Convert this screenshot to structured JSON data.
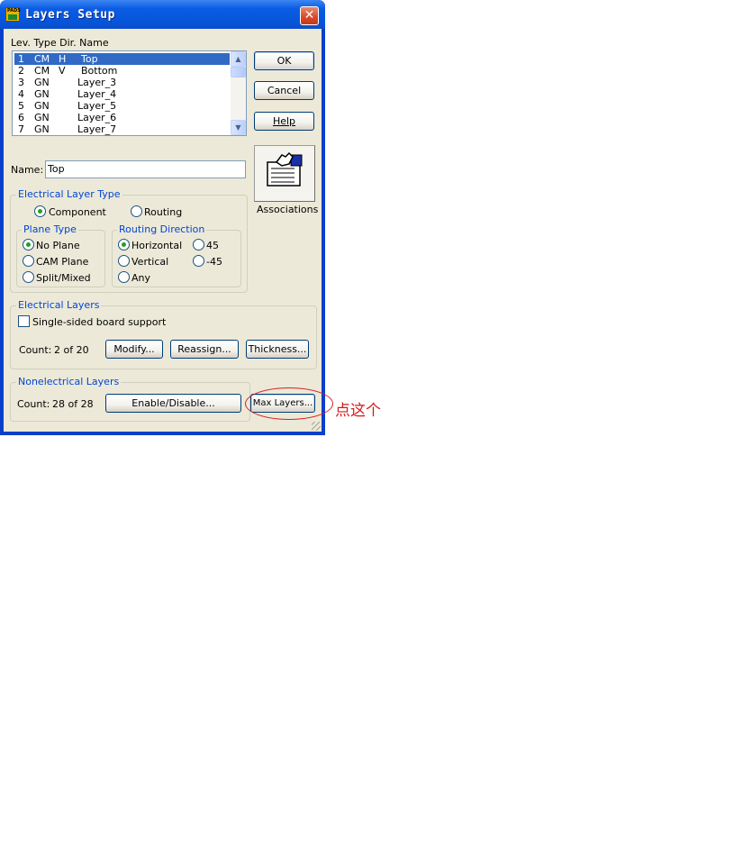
{
  "window": {
    "title": "Layers Setup",
    "app_icon_text": "PADS"
  },
  "list": {
    "header": "Lev. Type Dir. Name",
    "rows": [
      {
        "lev": "1",
        "type": "CM",
        "dir": "H",
        "name": "Top"
      },
      {
        "lev": "2",
        "type": "CM",
        "dir": "V",
        "name": "Bottom"
      },
      {
        "lev": "3",
        "type": "GN",
        "dir": "",
        "name": "Layer_3"
      },
      {
        "lev": "4",
        "type": "GN",
        "dir": "",
        "name": "Layer_4"
      },
      {
        "lev": "5",
        "type": "GN",
        "dir": "",
        "name": "Layer_5"
      },
      {
        "lev": "6",
        "type": "GN",
        "dir": "",
        "name": "Layer_6"
      },
      {
        "lev": "7",
        "type": "GN",
        "dir": "",
        "name": "Layer_7"
      }
    ],
    "selected": "1"
  },
  "buttons": {
    "ok": "OK",
    "cancel": "Cancel",
    "help": "Help",
    "associations": "Associations"
  },
  "name_field": {
    "label": "Name:",
    "value": "Top"
  },
  "electrical_layer_type": {
    "label": "Electrical  Layer Type",
    "component": "Component",
    "routing": "Routing",
    "selected": "Component"
  },
  "plane_type": {
    "label": "Plane Type",
    "options": [
      "No Plane",
      "CAM Plane",
      "Split/Mixed"
    ],
    "selected": "No Plane"
  },
  "routing_direction": {
    "label": "Routing Direction",
    "horizontal": "Horizontal",
    "vertical": "Vertical",
    "any": "Any",
    "deg45": "45",
    "deg_minus45": "-45",
    "selected": "Horizontal"
  },
  "electrical_layers": {
    "label": "Electrical Layers",
    "single_sided": "Single-sided board support",
    "single_sided_checked": false,
    "count_label": "Count:",
    "count_value": "2 of 20",
    "modify": "Modify...",
    "reassign": "Reassign...",
    "thickness": "Thickness..."
  },
  "nonelectrical_layers": {
    "label": "Nonelectrical Layers",
    "count_label": "Count:",
    "count_value": "28 of 28",
    "enable_disable": "Enable/Disable...",
    "max_layers": "Max Layers..."
  },
  "annotation": {
    "text": "点这个",
    "color": "#d41a1a"
  },
  "colors": {
    "title_bar": "#0656dc",
    "selection": "#316ac5",
    "group_label": "#0046d5",
    "dialog_bg": "#ece9d8"
  }
}
